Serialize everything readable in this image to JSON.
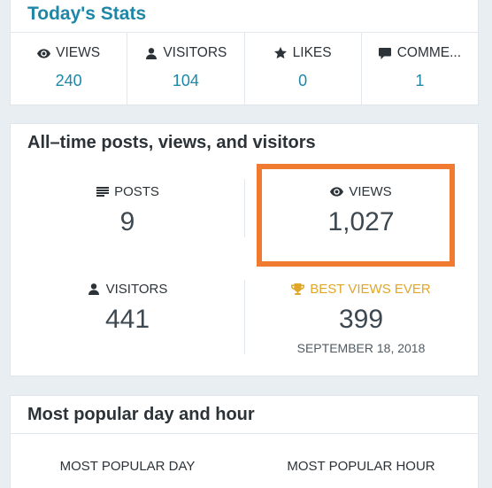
{
  "today": {
    "title": "Today's Stats",
    "stats": [
      {
        "label": "VIEWS",
        "value": "240",
        "icon": "eye-icon"
      },
      {
        "label": "VISITORS",
        "value": "104",
        "icon": "person-icon"
      },
      {
        "label": "LIKES",
        "value": "0",
        "icon": "star-icon"
      },
      {
        "label": "COMME...",
        "value": "1",
        "icon": "comment-icon"
      }
    ]
  },
  "all_time": {
    "title": "All–time posts, views, and visitors",
    "posts": {
      "label": "POSTS",
      "value": "9",
      "icon": "posts-list-icon"
    },
    "views": {
      "label": "VIEWS",
      "value": "1,027",
      "icon": "eye-icon"
    },
    "visitors": {
      "label": "VISITORS",
      "value": "441",
      "icon": "person-icon"
    },
    "best": {
      "label": "BEST VIEWS EVER",
      "value": "399",
      "date": "SEPTEMBER 18, 2018",
      "icon": "trophy-icon"
    }
  },
  "popular": {
    "title": "Most popular day and hour",
    "day_label": "MOST POPULAR DAY",
    "hour_label": "MOST POPULAR HOUR"
  },
  "colors": {
    "accent": "#1e87a8",
    "gold": "#e0a628",
    "highlight": "#f07b30"
  }
}
